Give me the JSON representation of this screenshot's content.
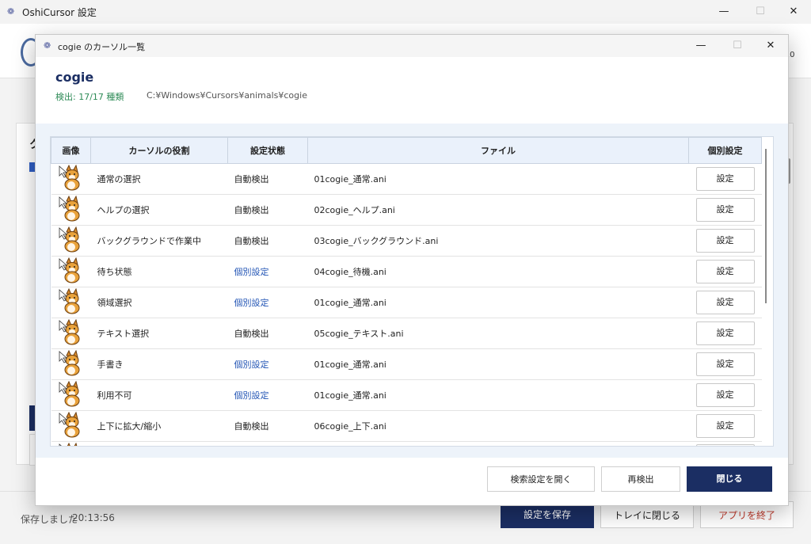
{
  "main_window": {
    "title": "OshiCursor 設定",
    "version_fragment": ".0",
    "panel_heading_fragment": "ク",
    "saved_status": "保存しました",
    "saved_time": "20:13:56",
    "buttons": {
      "save": "設定を保存",
      "close_to_tray": "トレイに閉じる",
      "quit": "アプリを終了"
    }
  },
  "window_controls": {
    "minimize": "—",
    "maximize": "☐",
    "close": "✕"
  },
  "dialog": {
    "title": "cogie のカーソル一覧",
    "cursor_set_name": "cogie",
    "detected": "検出: 17/17 種類",
    "path": "C:¥Windows¥Cursors¥animals¥cogie",
    "columns": {
      "image": "画像",
      "role": "カーソルの役割",
      "status": "設定状態",
      "file": "ファイル",
      "individual": "個別設定"
    },
    "rows": [
      {
        "role": "通常の選択",
        "status": "自動検出",
        "status_type": "auto",
        "file": "01cogie_通常.ani",
        "button": "設定"
      },
      {
        "role": "ヘルプの選択",
        "status": "自動検出",
        "status_type": "auto",
        "file": "02cogie_ヘルプ.ani",
        "button": "設定"
      },
      {
        "role": "バックグラウンドで作業中",
        "status": "自動検出",
        "status_type": "auto",
        "file": "03cogie_バックグラウンド.ani",
        "button": "設定"
      },
      {
        "role": "待ち状態",
        "status": "個別設定",
        "status_type": "custom",
        "file": "04cogie_待機.ani",
        "button": "設定"
      },
      {
        "role": "領域選択",
        "status": "個別設定",
        "status_type": "custom",
        "file": "01cogie_通常.ani",
        "button": "設定"
      },
      {
        "role": "テキスト選択",
        "status": "自動検出",
        "status_type": "auto",
        "file": "05cogie_テキスト.ani",
        "button": "設定"
      },
      {
        "role": "手書き",
        "status": "個別設定",
        "status_type": "custom",
        "file": "01cogie_通常.ani",
        "button": "設定"
      },
      {
        "role": "利用不可",
        "status": "個別設定",
        "status_type": "custom",
        "file": "01cogie_通常.ani",
        "button": "設定"
      },
      {
        "role": "上下に拡大/縮小",
        "status": "自動検出",
        "status_type": "auto",
        "file": "06cogie_上下.ani",
        "button": "設定"
      },
      {
        "role": "",
        "status": "",
        "status_type": "auto",
        "file": "",
        "button": ""
      }
    ],
    "buttons": {
      "open_search": "検索設定を開く",
      "redetect": "再検出",
      "close": "閉じる"
    }
  },
  "colors": {
    "accent_navy": "#1b2e63",
    "custom_status": "#2456b5",
    "detect_green": "#2e8b57",
    "danger": "#c0392b"
  }
}
